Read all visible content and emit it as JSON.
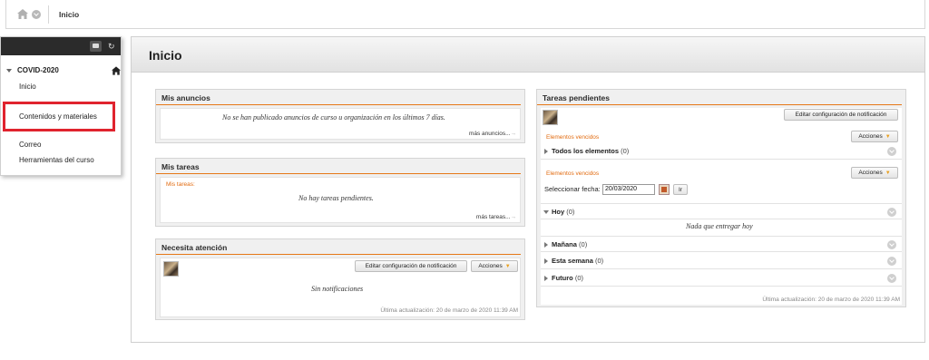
{
  "breadcrumb": {
    "current": "Inicio"
  },
  "course_menu": {
    "course_title": "COVID-2020",
    "items": [
      "Inicio",
      "Contenidos y materiales",
      "Correo",
      "Herramientas del curso"
    ]
  },
  "page": {
    "title": "Inicio"
  },
  "anuncios": {
    "title": "Mis anuncios",
    "message": "No se han publicado anuncios de curso u organización en los últimos 7 días.",
    "more": "más anuncios..."
  },
  "tareas": {
    "title": "Mis tareas",
    "label": "Mis tareas:",
    "message": "No hay tareas pendientes.",
    "more": "más tareas..."
  },
  "atencion": {
    "title": "Necesita atención",
    "edit_button": "Editar configuración de notificación",
    "actions_button": "Acciones",
    "message": "Sin notificaciones",
    "updated": "Última actualización: 20 de marzo de 2020 11:39 AM"
  },
  "pendientes": {
    "title": "Tareas pendientes",
    "edit_button": "Editar configuración de notificación",
    "overdue_label": "Elementos vencidos",
    "actions_button": "Acciones",
    "all_items": "Todos los elementos",
    "all_count": "(0)",
    "overdue_label2": "Elementos vencidos",
    "actions_button2": "Acciones",
    "date_label": "Seleccionar fecha:",
    "date_value": "20/03/2020",
    "go_button": "Ir",
    "today": "Hoy",
    "today_count": "(0)",
    "today_message": "Nada que entregar hoy",
    "tomorrow": "Mañana",
    "tomorrow_count": "(0)",
    "week": "Esta semana",
    "week_count": "(0)",
    "future": "Futuro",
    "future_count": "(0)",
    "updated": "Última actualización: 20 de marzo de 2020 11:39 AM"
  },
  "colors": {
    "accent": "#e67817",
    "highlight": "#e0232e",
    "menu_header": "#2b2b2b"
  }
}
